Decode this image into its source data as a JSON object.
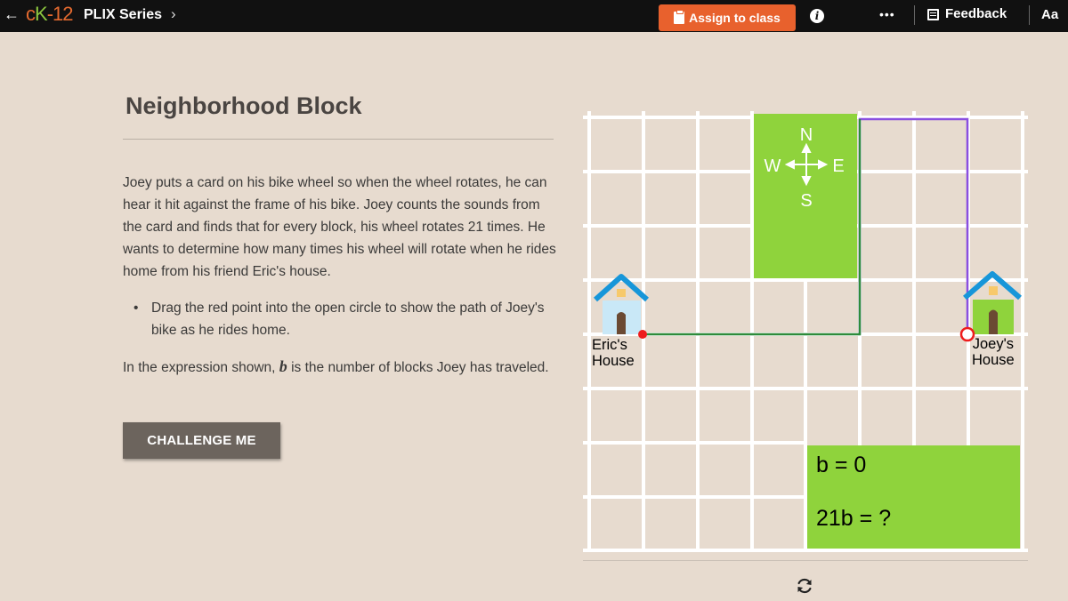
{
  "topbar": {
    "back_glyph": "←",
    "logo": {
      "c": "c",
      "k": "K",
      "dash_num": "-12"
    },
    "series_label": "PLIX Series",
    "chevron": "›",
    "assign_label": "Assign to class",
    "info_glyph": "i",
    "more_glyph": "•••",
    "feedback_label": "Feedback",
    "font_size_label": "Aa"
  },
  "lesson": {
    "title": "Neighborhood Block",
    "paragraph1": "Joey puts a card on his bike wheel so when the wheel rotates, he can hear it hit against the frame of his bike. Joey counts the sounds from the card and finds that for every block, his wheel rotates 21 times. He wants to determine how many times his wheel will rotate when he rides home from his friend Eric's house.",
    "bullet": "Drag the red point into the open circle to show the path of Joey's bike as he rides home.",
    "para2_before": "In the expression shown, ",
    "para2_var": "b",
    "para2_after": " is the number of blocks Joey has traveled.",
    "challenge_label": "CHALLENGE ME"
  },
  "map": {
    "compass": {
      "n": "N",
      "s": "S",
      "e": "E",
      "w": "W"
    },
    "eric_house_line1": "Eric's",
    "eric_house_line2": "House",
    "joey_house_line1": "Joey's",
    "joey_house_line2": "House",
    "expr_b": "b = 0",
    "expr_total": "21b = ?",
    "colors": {
      "park": "#8fd33c",
      "grid": "#ffffff",
      "path_green": "#2e8b3a",
      "path_purple": "#8a4fe0",
      "point": "#ee1c1c",
      "roof": "#1796d9"
    }
  },
  "icons": {
    "refresh": "refresh-icon"
  }
}
